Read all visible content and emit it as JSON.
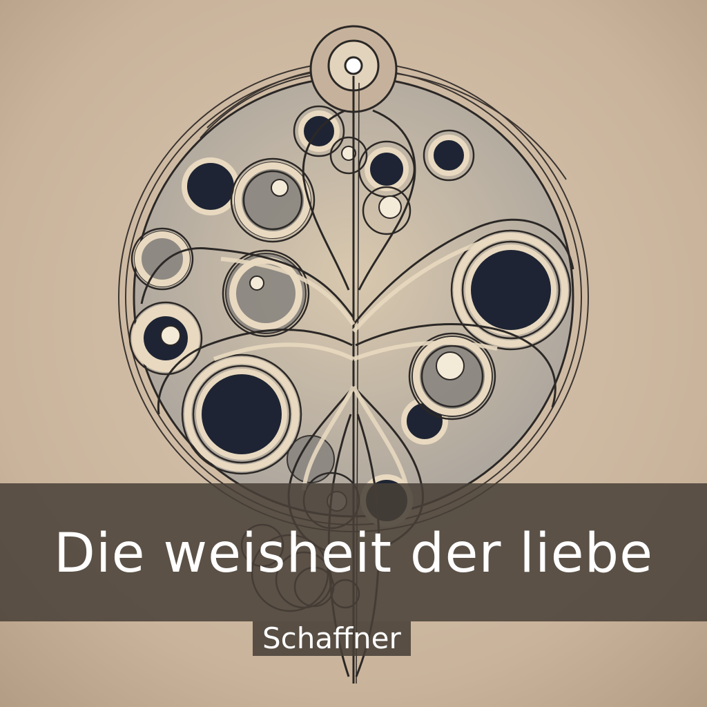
{
  "cover": {
    "title": "Die weisheit der liebe",
    "author": "Schaffner"
  },
  "colors": {
    "paper": "#cdb8a2",
    "ink": "#1e2433",
    "shade": "#8a8680",
    "cream": "#e8d9c0",
    "band": "#484038"
  },
  "artwork": {
    "icon": "ornamental-tree-of-circles-illustration"
  }
}
